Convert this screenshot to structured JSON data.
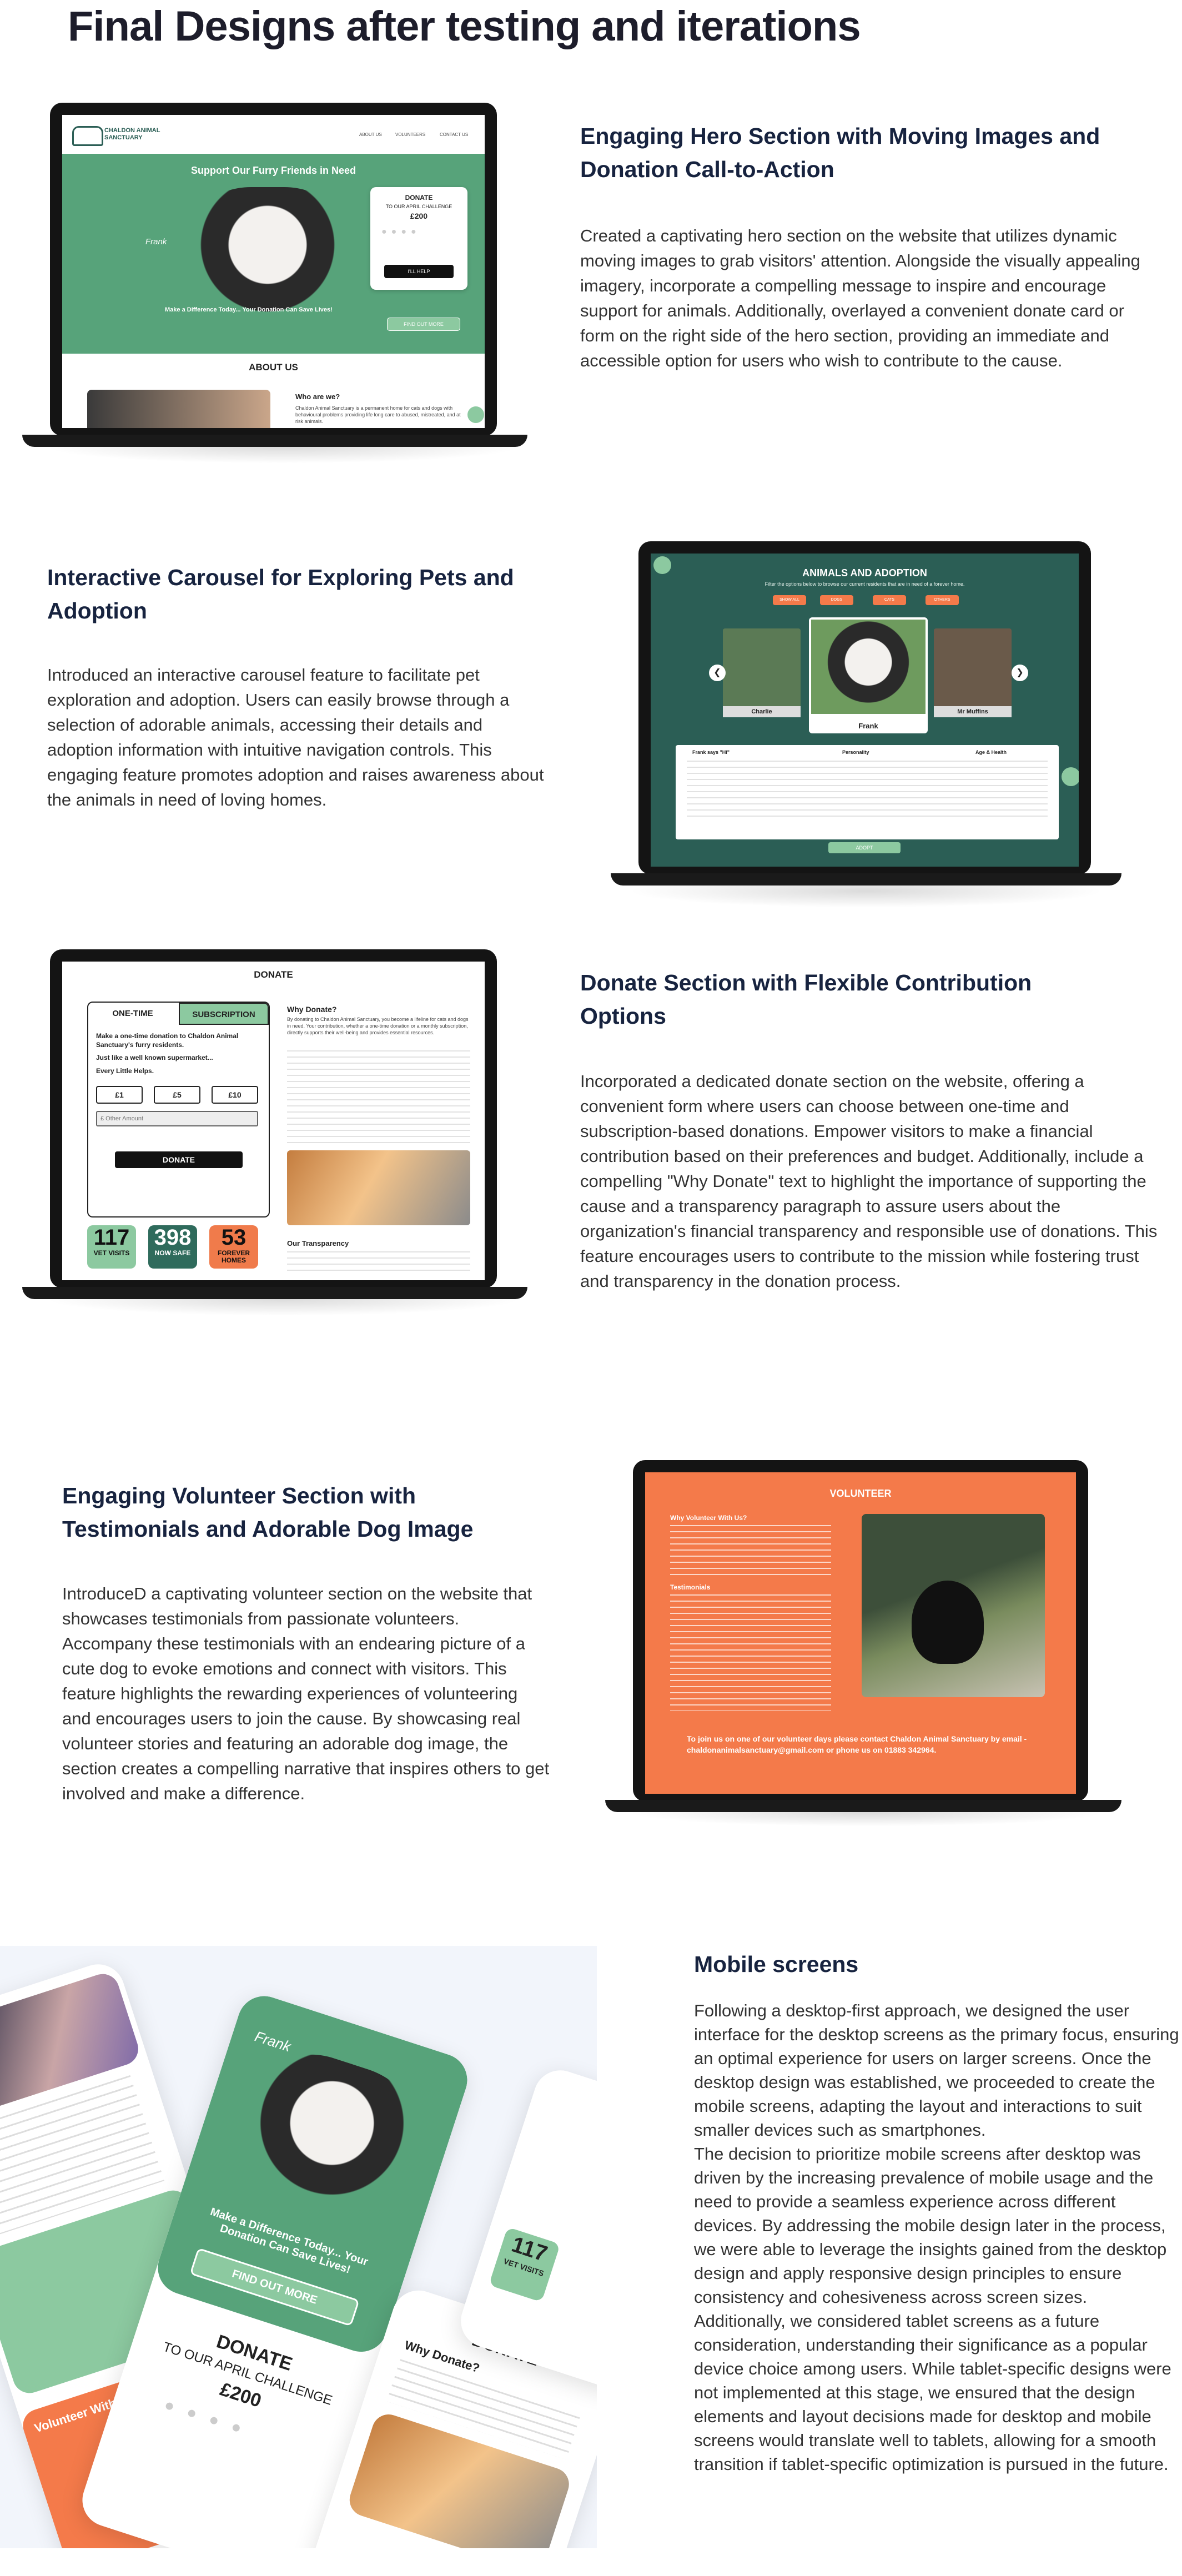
{
  "page_title": "Final Designs after testing and iterations",
  "sections": {
    "hero": {
      "heading": "Engaging Hero Section with Moving Images and Donation Call-to-Action",
      "body": "Created a captivating hero section on the website that utilizes dynamic moving images to grab visitors' attention. Alongside the visually appealing imagery, incorporate a compelling message to inspire and encourage support for animals. Additionally, overlayed a convenient donate card or form on the right side of the hero section, providing an immediate and accessible option for users who wish to contribute to the cause.",
      "screen": {
        "logo_text": "CHALDON ANIMAL SANCTUARY",
        "nav": [
          "ABOUT US",
          "VOLUNTEERS",
          "CONTACT US"
        ],
        "hero_title": "Support Our Furry Friends in Need",
        "pet_name": "Frank",
        "tagline": "Make a Difference Today... Your Donation Can Save Lives!",
        "find_out_more": "FIND OUT MORE",
        "donate_card": {
          "title": "DONATE",
          "subtitle": "TO OUR APRIL CHALLENGE",
          "amount": "£200",
          "button": "I'LL HELP"
        },
        "about_title": "ABOUT US",
        "about_sub": "Who are we?",
        "about_text": "Chaldon Animal Sanctuary is a permanent home for cats and dogs with behavioural problems providing life long care to abused, mistreated, and at risk animals."
      }
    },
    "carousel": {
      "heading": "Interactive Carousel for Exploring Pets and Adoption",
      "body": "Introduced an interactive carousel feature to facilitate pet exploration and adoption. Users can easily browse through a selection of adorable animals, accessing their details and adoption information with intuitive navigation controls. This engaging feature promotes adoption and raises awareness about the animals in need of loving homes.",
      "screen": {
        "title": "ANIMALS AND ADOPTION",
        "subtitle": "Filter the options below to browse our current residents that are in need of a forever home.",
        "filters": [
          "SHOW ALL",
          "DOGS",
          "CATS",
          "OTHERS"
        ],
        "pets": [
          "Charlie",
          "Frank",
          "Mr Muffins"
        ],
        "info_headers": [
          "Frank says \"Hi\"",
          "Personality",
          "Age & Health"
        ],
        "adopt": "ADOPT"
      }
    },
    "donate": {
      "heading": "Donate Section with Flexible Contribution Options",
      "body": "Incorporated a dedicated donate section on the website, offering a convenient form where users can choose between one-time and subscription-based donations. Empower visitors to make a financial contribution based on their preferences and budget. Additionally, include a compelling \"Why Donate\" text to highlight the importance of supporting the cause and a transparency paragraph to assure users about the organization's financial transparency and responsible use of donations. This feature encourages users to contribute to the mission while fostering trust and transparency in the donation process.",
      "screen": {
        "title": "DONATE",
        "tabs": [
          "ONE-TIME",
          "SUBSCRIPTION"
        ],
        "lead": "Make a one-time donation to Chaldon Animal Sanctuary's furry residents.",
        "lead2": "Just like a well known supermarket...",
        "lead3": "Every Little Helps.",
        "amounts": [
          "£1",
          "£5",
          "£10"
        ],
        "other_placeholder": "£ Other Amount",
        "donate_button": "DONATE",
        "stats": [
          {
            "number": "117",
            "label": "VET VISITS",
            "color": "#8cc9a0"
          },
          {
            "number": "398",
            "label": "NOW SAFE",
            "color": "#2f6b5c"
          },
          {
            "number": "53",
            "label": "FOREVER HOMES",
            "color": "#f07b4b"
          }
        ],
        "why_title": "Why Donate?",
        "why_text": "By donating to Chaldon Animal Sanctuary, you become a lifeline for cats and dogs in need. Your contribution, whether a one-time donation or a monthly subscription, directly supports their well-being and provides essential resources.",
        "transparency_title": "Our Transparency"
      }
    },
    "volunteer": {
      "heading": "Engaging Volunteer Section with Testimonials and Adorable Dog Image",
      "body": "IntroduceD a captivating volunteer section on the website that showcases testimonials from passionate volunteers. Accompany these testimonials with an endearing picture of a cute dog to evoke emotions and connect with visitors. This feature highlights the rewarding experiences of volunteering and encourages users to join the cause. By showcasing real volunteer stories and featuring an adorable dog image, the section creates a compelling narrative that inspires others to get involved and make a difference.",
      "screen": {
        "title": "VOLUNTEER",
        "why": "Why Volunteer With Us?",
        "testimonials": "Testimonials",
        "cta": "To join us on one of our volunteer days please contact Chaldon Animal Sanctuary by email - chaldonanimalsanctuary@gmail.com or phone us on 01883 342964."
      }
    },
    "mobile": {
      "heading": "Mobile screens",
      "body": "Following a desktop-first approach, we designed the user interface for the desktop screens as the primary focus, ensuring an optimal experience for users on larger screens. Once the desktop design was established, we proceeded to create the mobile screens, adapting the layout and interactions to suit smaller devices such as smartphones.\nThe decision to prioritize mobile screens after desktop was driven by the increasing prevalence of mobile usage and the need to provide a seamless experience across different devices. By addressing the mobile design later in the process, we were able to leverage the insights gained from the desktop design and apply responsive design principles to ensure consistency and cohesiveness across screen sizes.\nAdditionally, we considered tablet screens as a future consideration, understanding their significance as a popular device choice among users. While tablet-specific designs were not implemented at this stage, we ensured that the design elements and layout decisions made for desktop and mobile screens would translate well to tablets, allowing for a smooth transition if tablet-specific optimization is pursued in the future.",
      "phones": {
        "frank": "Frank",
        "tagline": "Make a Difference Today... Your Donation Can Save Lives!",
        "find_out_more": "FIND OUT MORE",
        "donate": "DONATE",
        "challenge": "TO OUR APRIL CHALLENGE",
        "amount": "£200",
        "why_donate": "Why Donate?",
        "stat_number": "117",
        "stat_label": "VET VISITS",
        "volunteer": "Volunteer With Us?"
      }
    }
  },
  "colors": {
    "green": "#57a37a",
    "dark_teal": "#2b5e55",
    "orange": "#f47a4a",
    "navy": "#17233f"
  }
}
